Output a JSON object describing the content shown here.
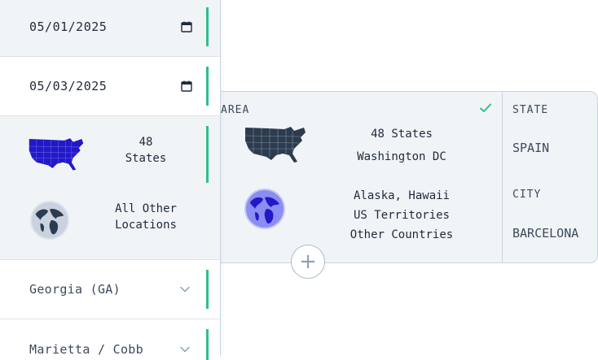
{
  "dates": {
    "start": {
      "value": "05/01/2025",
      "icon": "calendar-icon"
    },
    "end": {
      "value": "05/03/2025",
      "icon": "calendar-icon"
    }
  },
  "locations": {
    "lower48": {
      "line1": "48",
      "line2": "States",
      "icon": "usa-map-icon"
    },
    "other": {
      "line1": "All Other",
      "line2": "Locations",
      "icon": "globe-icon"
    }
  },
  "selects": {
    "state": {
      "value": "Georgia (GA)",
      "icon": "chevron-down-icon"
    },
    "county": {
      "value": "Marietta / Cobb",
      "icon": "chevron-down-icon"
    }
  },
  "card": {
    "area_label": "AREA",
    "options": [
      {
        "lines": [
          "48 States",
          "Washington DC"
        ],
        "icon": "usa-map-icon"
      },
      {
        "lines": [
          "Alaska, Hawaii",
          "US Territories",
          "Other Countries"
        ],
        "icon": "globe-icon"
      }
    ],
    "state_label": "STATE",
    "state_value": "SPAIN",
    "city_label": "CITY",
    "city_value": "BARCELONA",
    "add_label": "+"
  },
  "colors": {
    "accent": "#2fbf8a",
    "selected_map": "#2318c8",
    "dark_map": "#2d3b4e",
    "panel_bg": "#f1f4f7",
    "border": "#c9d4e0"
  }
}
